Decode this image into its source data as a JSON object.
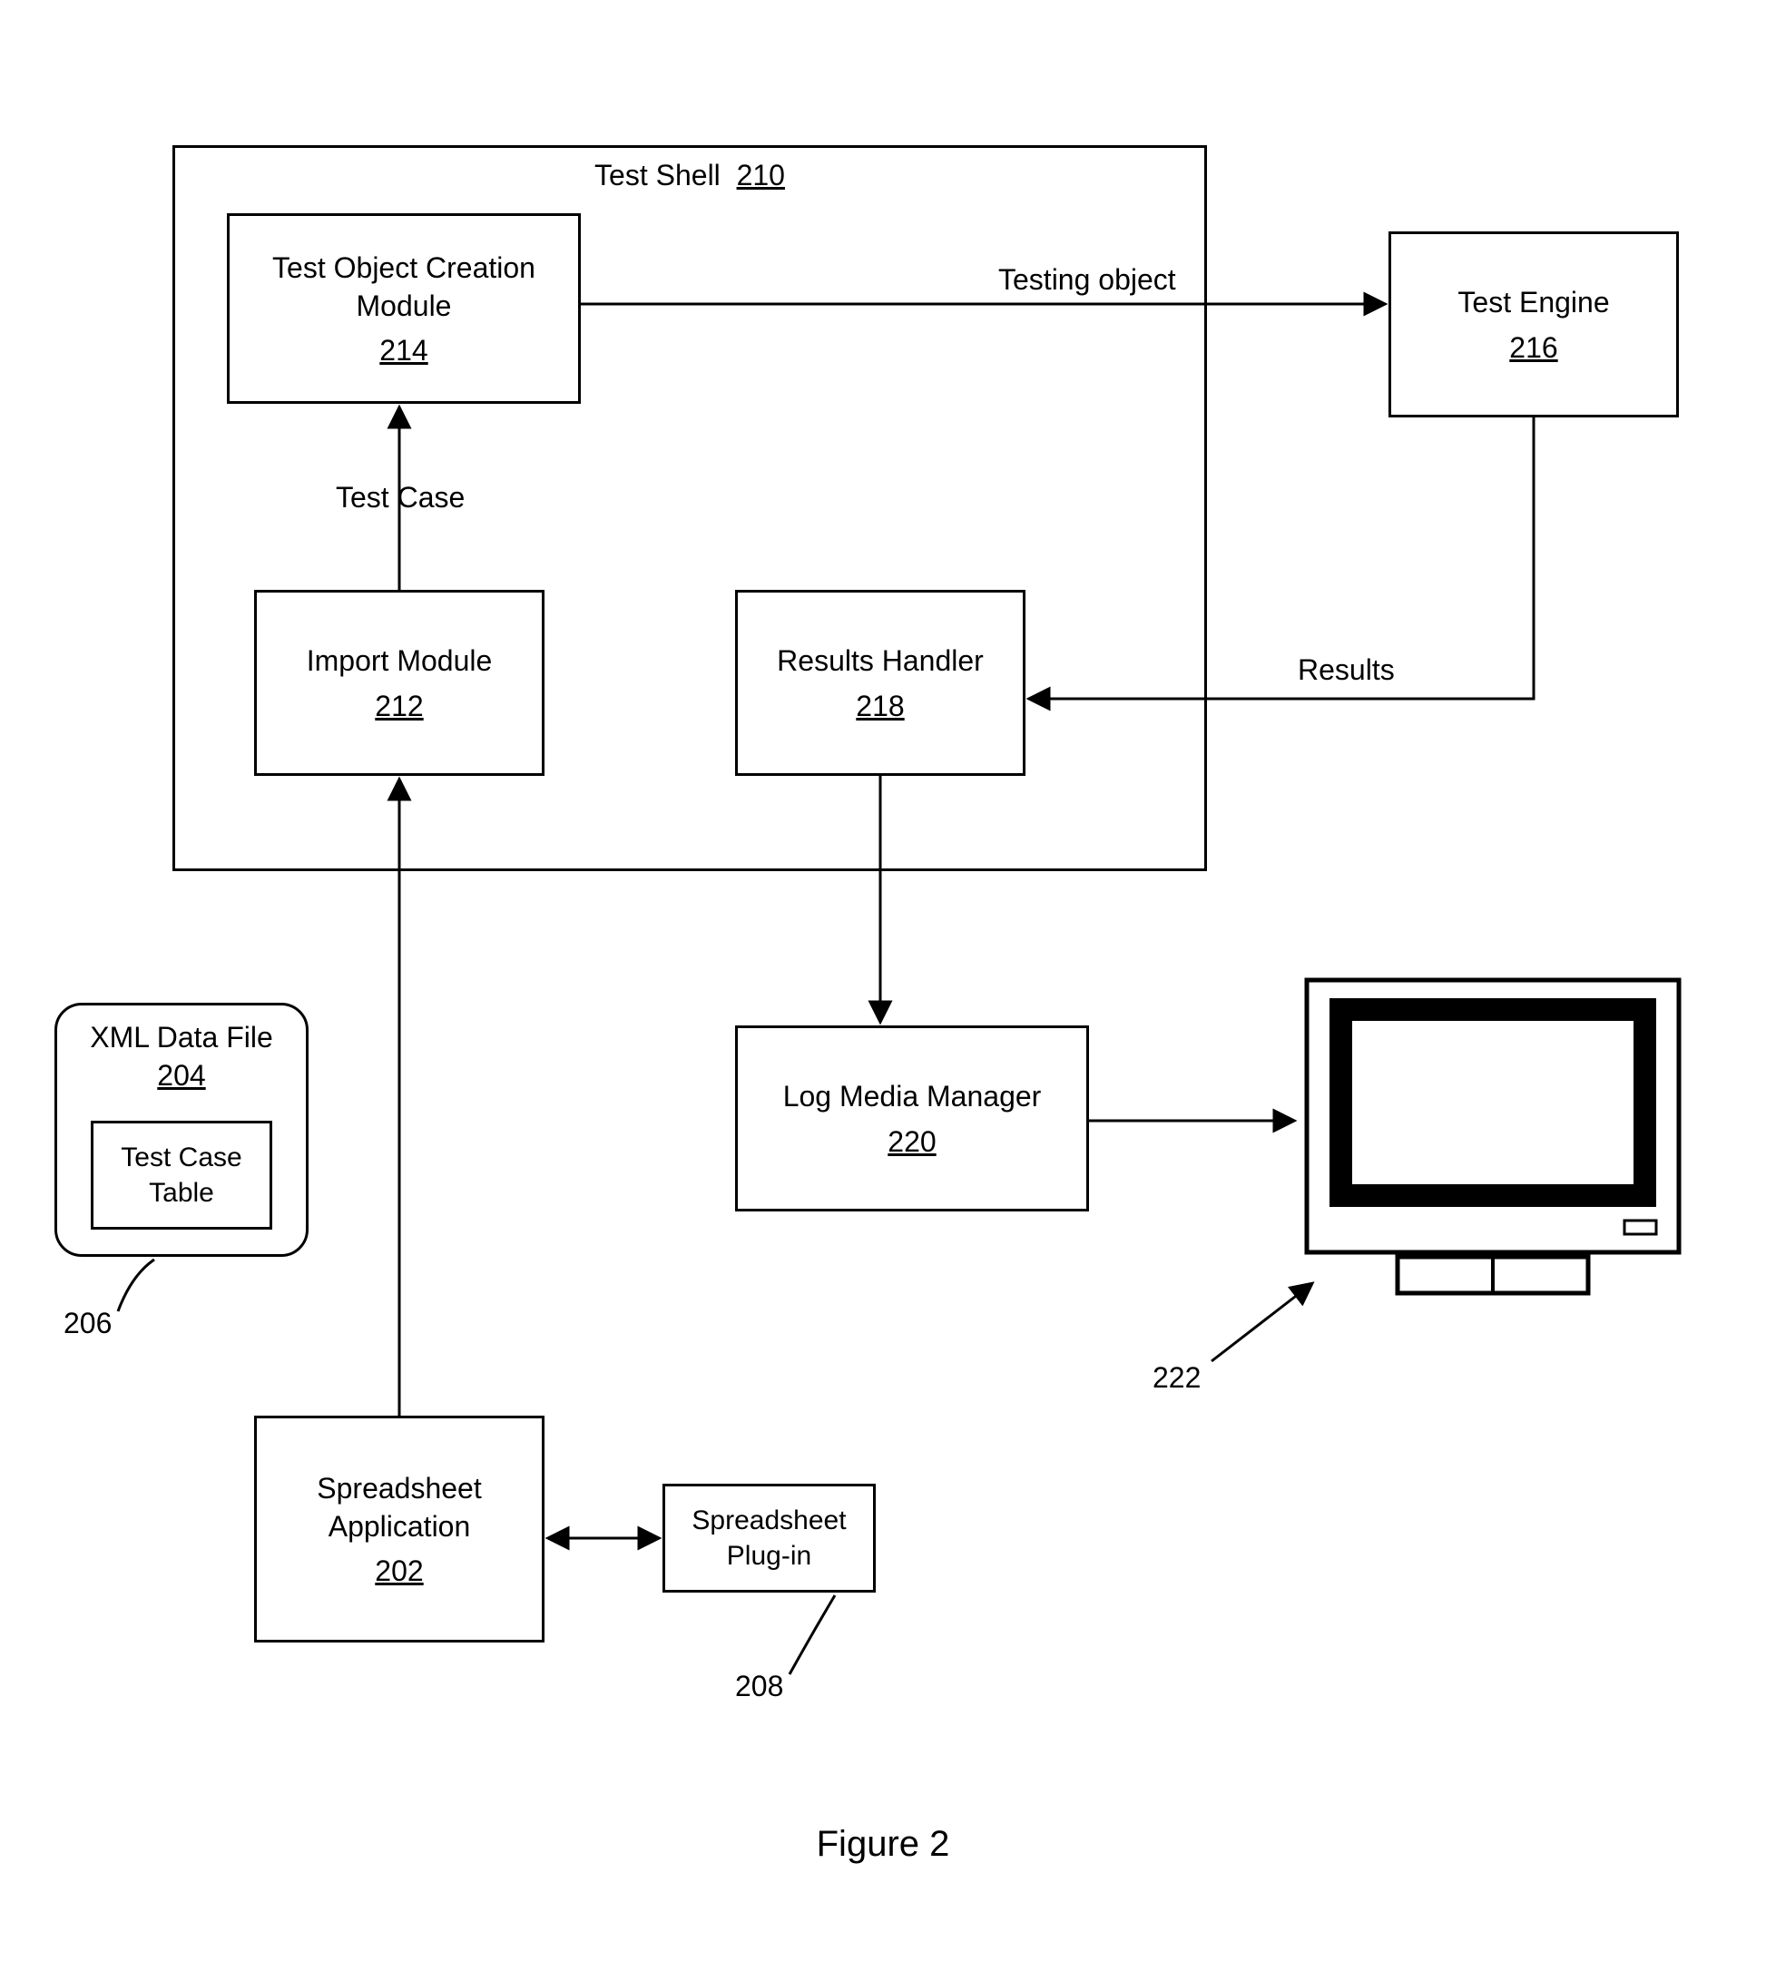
{
  "figure_caption": "Figure 2",
  "test_shell": {
    "title": "Test Shell",
    "num": "210"
  },
  "test_object_creation": {
    "title": "Test Object Creation Module",
    "num": "214"
  },
  "import_module": {
    "title": "Import Module",
    "num": "212"
  },
  "results_handler": {
    "title": "Results Handler",
    "num": "218"
  },
  "test_engine": {
    "title": "Test Engine",
    "num": "216"
  },
  "log_media_manager": {
    "title": "Log Media Manager",
    "num": "220"
  },
  "xml_file": {
    "title": "XML Data File",
    "num": "204"
  },
  "test_case_table": {
    "title": "Test Case Table"
  },
  "ref_206": "206",
  "spreadsheet_app": {
    "title": "Spreadsheet Application",
    "num": "202"
  },
  "spreadsheet_plugin": {
    "title": "Spreadsheet Plug-in"
  },
  "ref_208": "208",
  "ref_222": "222",
  "edge_testing_object": "Testing object",
  "edge_test_case": "Test Case",
  "edge_results": "Results"
}
